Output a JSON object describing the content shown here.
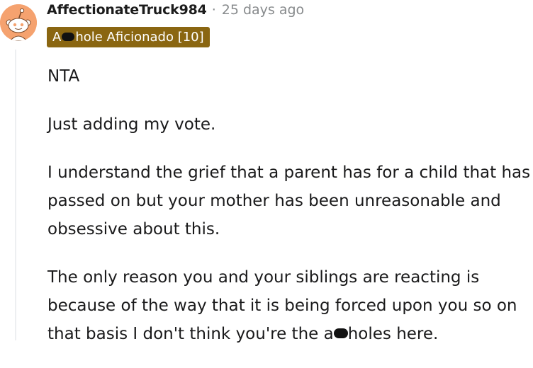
{
  "comment": {
    "username": "AffectionateTruck984",
    "separator": "·",
    "timestamp": "25 days ago",
    "flair": {
      "prefix": "A",
      "suffix": "hole Aficionado [10]",
      "background": "#8a6611",
      "text_color": "#ffffff"
    },
    "avatar": {
      "icon": "reddit-snoo-avatar-icon",
      "background": "#f5a26f"
    },
    "paragraphs": {
      "p1": "NTA",
      "p2": "Just adding my vote.",
      "p3": "I understand the grief that a parent has for a child that has passed on but your mother has been unreasonable and obsessive about this.",
      "p4_before_censor": "The only reason you and your siblings are reacting is because of the way that it is being forced upon you so on that basis I don't think you're the a",
      "p4_after_censor": "holes here."
    }
  }
}
